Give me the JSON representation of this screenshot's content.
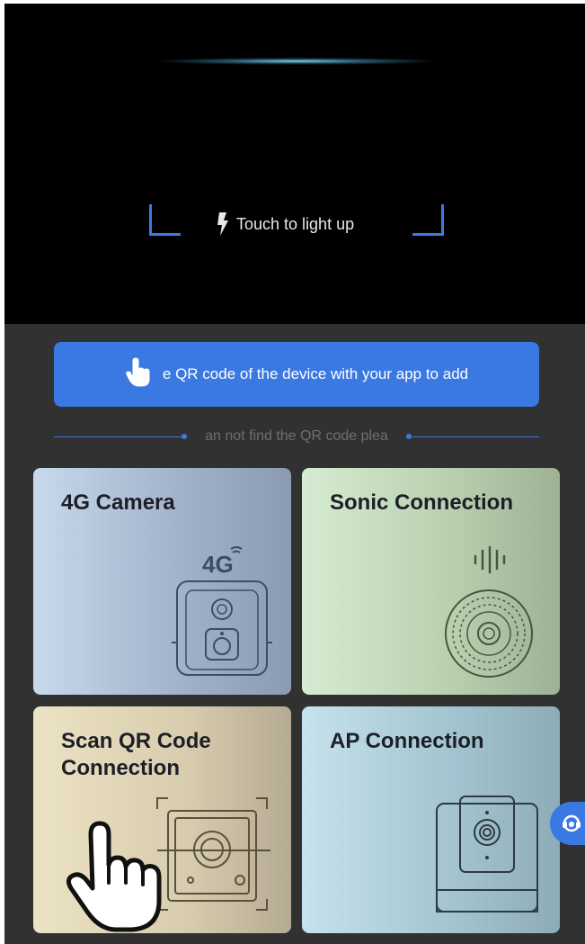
{
  "scanner": {
    "torch_label": "Touch to light up",
    "icons": [
      "flash-icon"
    ]
  },
  "main": {
    "scan_instruction": "e QR code of the device with your app to add",
    "hint_text": "an not find the QR code plea",
    "cards": [
      {
        "title": "4G Camera",
        "icon": "4g-camera-illustration",
        "badge": "4G"
      },
      {
        "title": "Sonic Connection",
        "icon": "sonic-camera-illustration"
      },
      {
        "title": "Scan QR Code Connection",
        "icon": "qr-scan-illustration"
      },
      {
        "title": "AP Connection",
        "icon": "ap-camera-illustration"
      }
    ]
  },
  "support": {
    "icon": "customer-service-icon"
  },
  "colors": {
    "accent": "#3a78e2",
    "background": "#313131",
    "scanner_background": "#000000"
  }
}
